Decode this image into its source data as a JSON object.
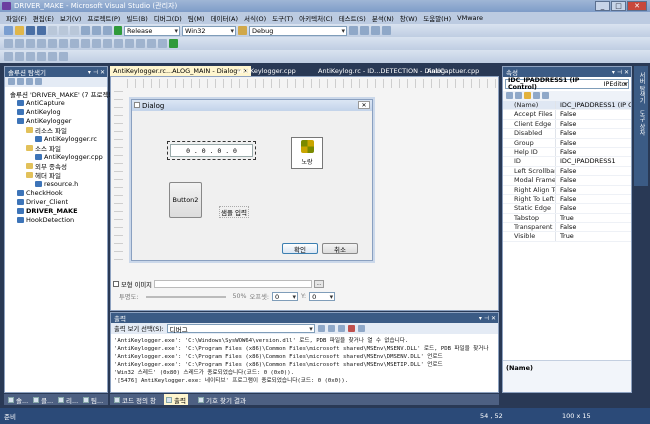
{
  "window": {
    "title": "DRIVER_MAKE - Microsoft Visual Studio (관리자)",
    "controls": [
      "_",
      "□",
      "✕"
    ]
  },
  "menu": [
    "파일(F)",
    "편집(E)",
    "보기(V)",
    "프로젝트(P)",
    "빌드(B)",
    "디버그(D)",
    "팀(M)",
    "데이터(A)",
    "서식(O)",
    "도구(T)",
    "아키텍처(C)",
    "테스트(S)",
    "분석(N)",
    "창(W)",
    "도움말(H)",
    "VMware"
  ],
  "toolbar": {
    "config": "Release",
    "platform": "Win32",
    "find": "Debug"
  },
  "solution_explorer": {
    "title": "솔루션 탐색기",
    "items": [
      {
        "label": "솔루션 'DRIVER_MAKE' (7 프로젝트)",
        "indent": 0,
        "bold": false
      },
      {
        "label": "AntiCapture",
        "indent": 1,
        "bold": false
      },
      {
        "label": "AntiKeylog",
        "indent": 1,
        "bold": false
      },
      {
        "label": "AntiKeylogger",
        "indent": 1,
        "bold": false
      },
      {
        "label": "리소스 파일",
        "indent": 2,
        "bold": false
      },
      {
        "label": "AntiKeylogger.rc",
        "indent": 3,
        "bold": false
      },
      {
        "label": "소스 파일",
        "indent": 2,
        "bold": false
      },
      {
        "label": "AntiKeylogger.cpp",
        "indent": 3,
        "bold": false
      },
      {
        "label": "외부 종속성",
        "indent": 2,
        "bold": false
      },
      {
        "label": "헤더 파일",
        "indent": 2,
        "bold": false
      },
      {
        "label": "resource.h",
        "indent": 3,
        "bold": false
      },
      {
        "label": "CheckHook",
        "indent": 1,
        "bold": false
      },
      {
        "label": "Driver_Client",
        "indent": 1,
        "bold": false
      },
      {
        "label": "DRIVER_MAKE",
        "indent": 1,
        "bold": true
      },
      {
        "label": "HookDetection",
        "indent": 1,
        "bold": false
      }
    ]
  },
  "doc_tabs": [
    {
      "label": "AntiKeylogger.rc...ALOG_MAIN - Dialog*",
      "active": true,
      "close": "✕"
    },
    {
      "label": "AntiKeylogger.cpp",
      "active": false
    },
    {
      "label": "AntiKeylog.rc - ID...DETECTION - Dialog",
      "active": false
    },
    {
      "label": "AntiCaptuer.cpp",
      "active": false
    }
  ],
  "dialog": {
    "title": "Dialog",
    "ip_text": "0 . 0 . 0 . 0",
    "icon_label": "노랑",
    "button2": "Button2",
    "static_text": "샘플 입력",
    "ok": "확인",
    "cancel": "취소"
  },
  "image_toolbar": {
    "checkbox": "모형 이미지",
    "transparency_label": "투명도:",
    "percent": "50%",
    "offset_label": "오프셋:",
    "offset_x": "0",
    "offset_y": "0",
    "y_label": "Y:"
  },
  "properties": {
    "title": "속성",
    "object": "IDC_IPADDRESS1 (IP Control)",
    "object_type": "IPEditor",
    "header_name": "(Name)",
    "header_value": "IDC_IPADDRESS1 (IP C",
    "rows": [
      [
        "Accept Files",
        "False"
      ],
      [
        "Client Edge",
        "False"
      ],
      [
        "Disabled",
        "False"
      ],
      [
        "Group",
        "False"
      ],
      [
        "Help ID",
        "False"
      ],
      [
        "ID",
        "IDC_IPADDRESS1"
      ],
      [
        "Left Scrollbar",
        "False"
      ],
      [
        "Modal Frame",
        "False"
      ],
      [
        "Right Align Text",
        "False"
      ],
      [
        "Right To Left Reading",
        "False"
      ],
      [
        "Static Edge",
        "False"
      ],
      [
        "Tabstop",
        "True"
      ],
      [
        "Transparent",
        "False"
      ],
      [
        "Visible",
        "True"
      ]
    ],
    "footer": "(Name)",
    "side_tabs": [
      "서버 탐색기",
      "도구 상자"
    ]
  },
  "output": {
    "title": "출력",
    "show_label": "출력 보기 선택(S):",
    "source": "디버그",
    "lines": [
      "'AntiKeylogger.exe': 'C:\\Windows\\SysWOW64\\version.dll' 로드, PDB 파일을 찾거나 열 수 없습니다.",
      "'AntiKeylogger.exe': 'C:\\Program Files (x86)\\Common Files\\microsoft shared\\MSEnv\\MSENV.DLL' 로드, PDB 파일을 찾거나",
      "'AntiKeylogger.exe': 'C:\\Program Files (x86)\\Common Files\\microsoft shared\\MSEnv\\DMSENV.DLL' 언로드",
      "'AntiKeylogger.exe': 'C:\\Program Files (x86)\\Common Files\\microsoft shared\\MSEnv\\MSETIP.DLL' 언로드",
      "'Win32 스레드' (0x80) 스레드가 종료되었습니다(코드: 0 (0x0)).",
      "'[5476] AntiKeylogger.exe: 네이티브' 프로그램이 종료되었습니다(코드: 0 (0x0))."
    ]
  },
  "left_bottom_tabs": [
    "솔...",
    "클...",
    "리...",
    "팀..."
  ],
  "bottom_tabs": [
    "코드 정의 창",
    "출력",
    "기호 찾기 결과"
  ],
  "status": {
    "ready": "준비",
    "position": "54 , 52",
    "size": "100 x 15"
  }
}
